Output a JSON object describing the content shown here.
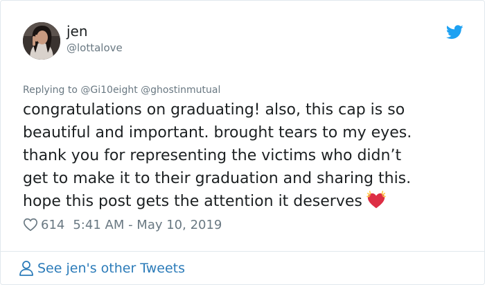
{
  "author": {
    "display_name": "jen",
    "handle": "@lottalove"
  },
  "reply": {
    "prefix": "Replying to",
    "mentions": [
      "@Gi10eight",
      "@ghostinmutual"
    ]
  },
  "tweet": {
    "lines": [
      "congratulations on graduating! also, this cap is so",
      "beautiful and important. brought tears to my eyes.",
      "thank you for representing the victims who didn’t",
      "get to make it to their graduation and sharing this.",
      "hope this post gets the attention it deserves"
    ],
    "emoji": "sparkling-heart"
  },
  "meta": {
    "like_count": "614",
    "timestamp": "5:41 AM - May 10, 2019"
  },
  "footer": {
    "link_text": "See jen's other Tweets"
  },
  "colors": {
    "text": "#1c2022",
    "muted": "#697882",
    "link": "#2b7bb9",
    "twitter_blue": "#1da1f2",
    "border": "#e1e8ed",
    "heart": "#e0245e"
  },
  "icons": {
    "brand": "twitter-bird-icon",
    "like": "heart-outline-icon",
    "profile": "person-icon"
  }
}
